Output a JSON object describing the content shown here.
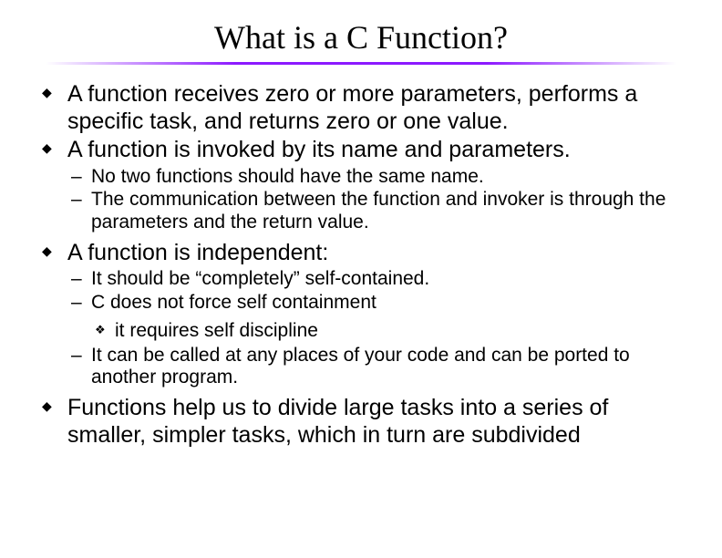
{
  "title": "What is a C Function?",
  "bullets": {
    "b1": "A function receives zero or more parameters, performs a specific task, and returns zero or one value.",
    "b2": "A function is invoked by its name and parameters.",
    "b2_1": "No two functions should have the same name.",
    "b2_2": "The communication between the function and invoker is through the parameters and the return value.",
    "b3": "A function is independent:",
    "b3_1": "It should be “completely” self-contained.",
    "b3_2": "C does not force self containment",
    "b3_2_1": "it requires self discipline",
    "b3_3": "It can be called at any places of your code and can be ported to another program.",
    "b4": "Functions help us to divide large tasks into a series of smaller, simpler tasks, which in turn are subdivided"
  }
}
